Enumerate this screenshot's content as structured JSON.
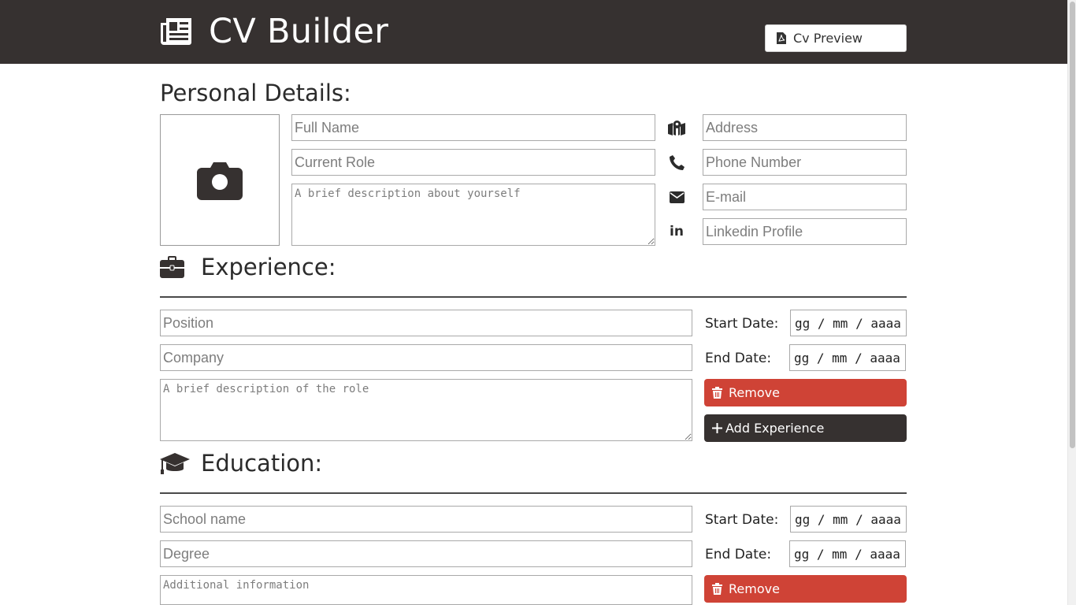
{
  "header": {
    "title": "CV Builder",
    "preview_label": "Cv Preview"
  },
  "personal": {
    "title": "Personal Details:",
    "full_name_placeholder": "Full Name",
    "role_placeholder": "Current Role",
    "description_placeholder": "A brief description about yourself",
    "address_placeholder": "Address",
    "phone_placeholder": "Phone Number",
    "email_placeholder": "E-mail",
    "linkedin_placeholder": "Linkedin Profile",
    "linkedin_icon_text": "in"
  },
  "experience": {
    "title": "Experience:",
    "position_placeholder": "Position",
    "company_placeholder": "Company",
    "description_placeholder": "A brief description of the role",
    "start_label": "Start Date:",
    "end_label": "End Date:",
    "start_value": "gg / mm / aaaa",
    "end_value": "gg / mm / aaaa",
    "remove_label": "Remove",
    "add_label": "Add Experience"
  },
  "education": {
    "title": "Education:",
    "school_placeholder": "School name",
    "degree_placeholder": "Degree",
    "info_placeholder": "Additional information",
    "start_label": "Start Date:",
    "end_label": "End Date:",
    "start_value": "gg / mm / aaaa",
    "end_value": "gg / mm / aaaa",
    "remove_label": "Remove"
  },
  "colors": {
    "header_bg": "#363130",
    "remove_bg": "#cf4336",
    "add_bg": "#363130"
  },
  "icons": [
    "newspaper-icon",
    "file-pdf-icon",
    "camera-icon",
    "map-icon",
    "phone-icon",
    "envelope-icon",
    "linkedin-icon",
    "briefcase-icon",
    "graduation-cap-icon",
    "trash-icon",
    "plus-icon"
  ]
}
